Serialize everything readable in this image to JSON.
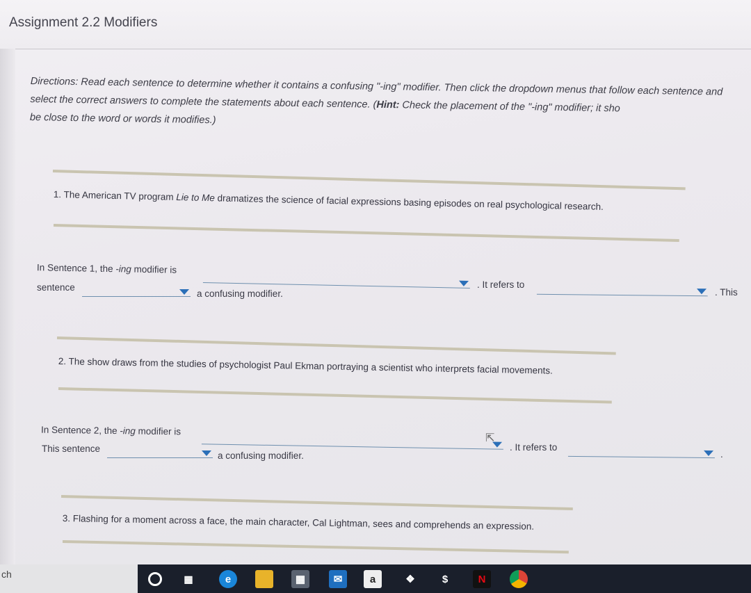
{
  "header": {
    "title": "Assignment 2.2 Modifiers"
  },
  "directions": {
    "lead": "Directions:",
    "text1": " Read each sentence to determine whether it contains a confusing \"-ing\" modifier. Then click the dropdown menus that follow each sentence and select the correct answers to complete the statements about each sentence. (",
    "hint_label": "Hint:",
    "text2": " Check the placement of the \"-ing\" modifier; it sho",
    "text3": "be close to the word or words it modifies.)"
  },
  "questions": [
    {
      "sentence_prefix": "1. The American TV program ",
      "sentence_title": "Lie to Me",
      "sentence_suffix": " dramatizes the science of facial expressions basing episodes on real psychological research.",
      "line1_a": "In Sentence 1, the ",
      "line1_ing": "-ing",
      "line1_b": " modifier is",
      "refers_label": ". It refers to",
      "end_label": ". This",
      "line2_a": "sentence",
      "line2_b": "a confusing modifier."
    },
    {
      "sentence": "2. The show draws from the studies of psychologist Paul Ekman portraying a scientist who interprets facial movements.",
      "line1_a": "In Sentence 2, the ",
      "line1_ing": "-ing",
      "line1_b": " modifier is",
      "refers_label": ". It refers to",
      "end_label": ".",
      "line2_a": "This sentence",
      "line2_b": "a confusing modifier."
    },
    {
      "sentence": "3. Flashing for a moment across a face, the main character, Cal Lightman, sees and comprehends an expression."
    }
  ],
  "taskbar": {
    "search_label": "ch",
    "icons": [
      "cortana-icon",
      "task-view-icon",
      "edge-icon",
      "file-explorer-icon",
      "store-icon",
      "mail-icon",
      "amazon-icon",
      "dropbox-icon",
      "dollar-app-icon",
      "netflix-icon",
      "chrome-icon"
    ],
    "amazon_letter": "a",
    "netflix_letter": "N",
    "dollar_symbol": "$"
  }
}
